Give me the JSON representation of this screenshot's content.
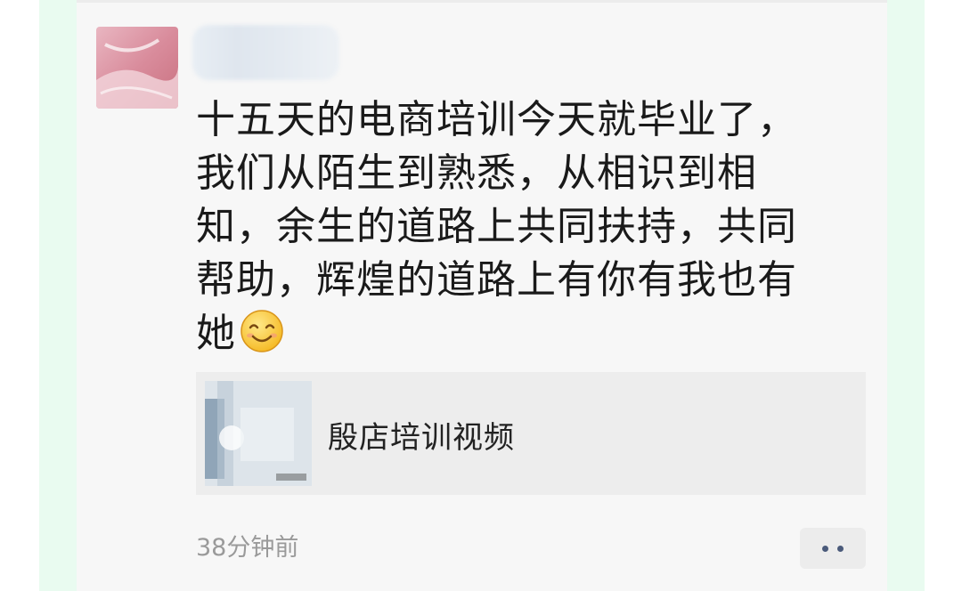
{
  "post": {
    "text_lines": [
      "十五天的电商培训今天就毕业了，",
      "我们从陌生到熟悉，从相识到相",
      "知，余生的道路上共同扶持，共同",
      "帮助，辉煌的道路上有你有我也有",
      "她"
    ],
    "emoji": "smile-emoji"
  },
  "link": {
    "title": "殷店培训视频",
    "thumbnail_icon": "video-thumbnail"
  },
  "footer": {
    "timestamp": "38分钟前",
    "more_icon": "more-dots-icon"
  },
  "colors": {
    "green_side": "#e9fbf0",
    "panel_bg": "#f7f7f7",
    "card_bg": "#ededed",
    "timestamp_color": "#9a9a9a",
    "dots_color": "#4a5a7a"
  }
}
